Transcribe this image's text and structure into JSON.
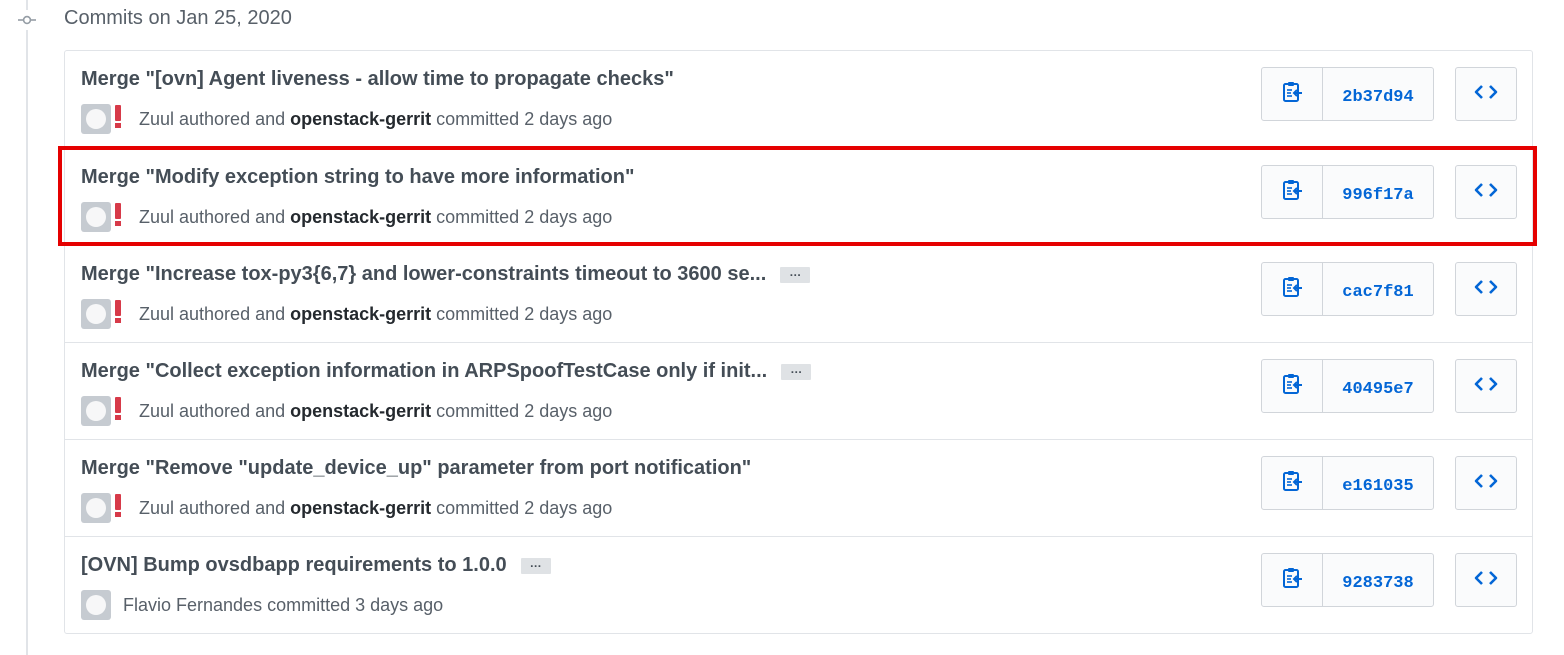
{
  "header": {
    "date_label": "Commits on Jan 25, 2020"
  },
  "colors": {
    "link_blue": "#0366d6",
    "highlight_red": "#e50000",
    "muted_text": "#586069"
  },
  "icons": {
    "timeline": "git-commit-icon",
    "copy": "clipboard-icon",
    "browse": "code-icon"
  },
  "commits": [
    {
      "title": "Merge \"[ovn] Agent liveness - allow time to propagate checks\"",
      "truncated": false,
      "author": "Zuul",
      "authored_text": " authored and ",
      "committer": "openstack-gerrit",
      "committed_text": " committed 2 days ago",
      "sha": "2b37d94"
    },
    {
      "title": "Merge \"Modify exception string to have more information\"",
      "truncated": false,
      "author": "Zuul",
      "authored_text": " authored and ",
      "committer": "openstack-gerrit",
      "committed_text": " committed 2 days ago",
      "sha": "996f17a",
      "highlighted": true
    },
    {
      "title": "Merge \"Increase tox-py3{6,7} and lower-constraints timeout to 3600 se...",
      "truncated": true,
      "author": "Zuul",
      "authored_text": " authored and ",
      "committer": "openstack-gerrit",
      "committed_text": " committed 2 days ago",
      "sha": "cac7f81"
    },
    {
      "title": "Merge \"Collect exception information in ARPSpoofTestCase only if init...",
      "truncated": true,
      "author": "Zuul",
      "authored_text": " authored and ",
      "committer": "openstack-gerrit",
      "committed_text": " committed 2 days ago",
      "sha": "40495e7"
    },
    {
      "title": "Merge \"Remove \"update_device_up\" parameter from port notification\"",
      "truncated": false,
      "author": "Zuul",
      "authored_text": " authored and ",
      "committer": "openstack-gerrit",
      "committed_text": " committed 2 days ago",
      "sha": "e161035"
    },
    {
      "title": "[OVN] Bump ovsdbapp requirements to 1.0.0",
      "truncated": true,
      "author": "Flavio Fernandes",
      "authored_text": " committed 3 days ago",
      "committer": "",
      "committed_text": "",
      "sha": "9283738",
      "single_avatar": true
    }
  ]
}
